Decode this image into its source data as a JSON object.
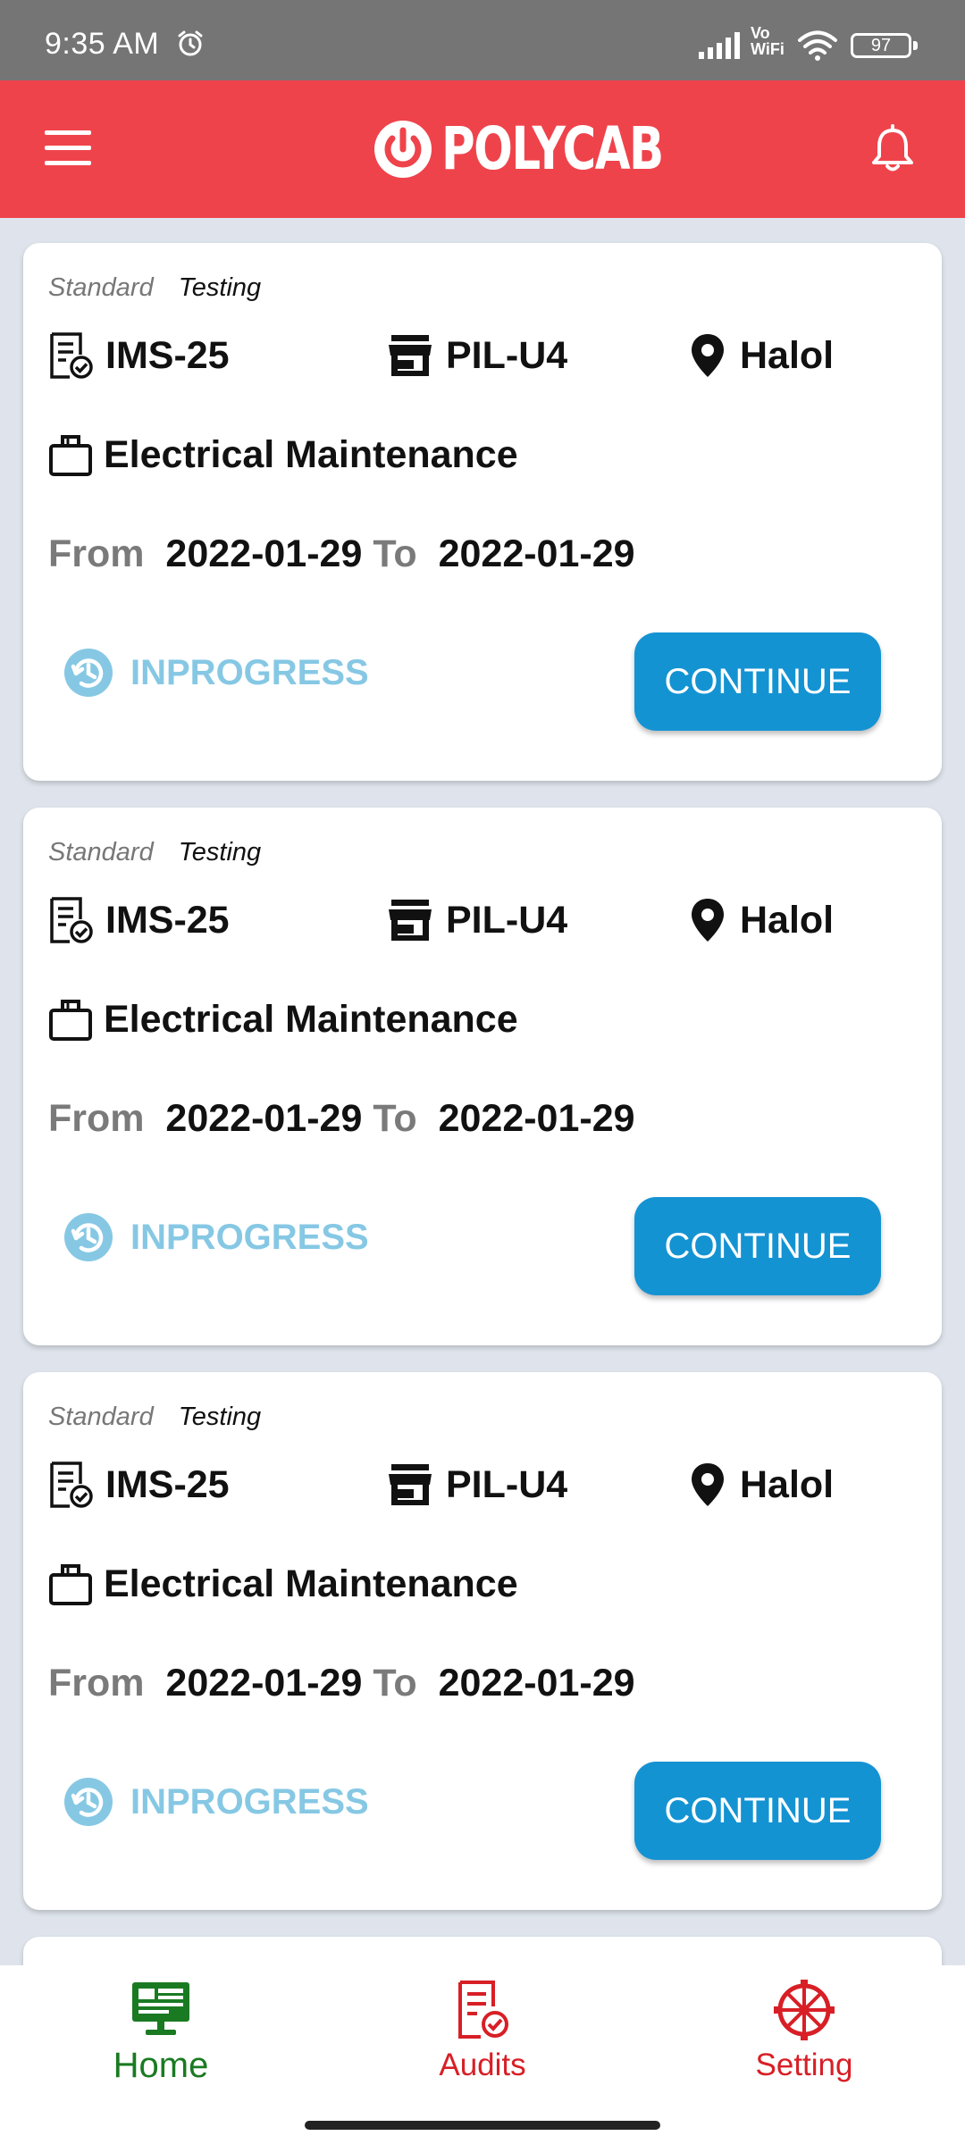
{
  "status_bar": {
    "time": "9:35 AM",
    "vowifi_top": "Vo",
    "vowifi_bottom": "WiFi",
    "battery": "97"
  },
  "app_bar": {
    "logo_text": "POLYCAB",
    "brand_color": "#ef434b"
  },
  "cards": [
    {
      "tag_type": "Standard",
      "tag_mode": "Testing",
      "audit_code": "IMS-25",
      "plant": "PIL-U4",
      "location": "Halol",
      "department": "Electrical Maintenance",
      "from_label": "From",
      "from_date": "2022-01-29",
      "to_label": "To",
      "to_date": "2022-01-29",
      "status": "INPROGRESS",
      "action": "CONTINUE"
    },
    {
      "tag_type": "Standard",
      "tag_mode": "Testing",
      "audit_code": "IMS-25",
      "plant": "PIL-U4",
      "location": "Halol",
      "department": "Electrical Maintenance",
      "from_label": "From",
      "from_date": "2022-01-29",
      "to_label": "To",
      "to_date": "2022-01-29",
      "status": "INPROGRESS",
      "action": "CONTINUE"
    },
    {
      "tag_type": "Standard",
      "tag_mode": "Testing",
      "audit_code": "IMS-25",
      "plant": "PIL-U4",
      "location": "Halol",
      "department": "Electrical Maintenance",
      "from_label": "From",
      "from_date": "2022-01-29",
      "to_label": "To",
      "to_date": "2022-01-29",
      "status": "INPROGRESS",
      "action": "CONTINUE"
    }
  ],
  "bottom_nav": {
    "items": [
      {
        "label": "Home",
        "icon": "monitor-icon",
        "active": true
      },
      {
        "label": "Audits",
        "icon": "audit-document-icon",
        "active": false
      },
      {
        "label": "Setting",
        "icon": "gear-wheel-icon",
        "active": false
      }
    ]
  },
  "colors": {
    "accent": "#1493d3",
    "status_inprogress": "#86c8e4",
    "nav_active": "#1a7a22",
    "nav_inactive": "#d81f26"
  }
}
